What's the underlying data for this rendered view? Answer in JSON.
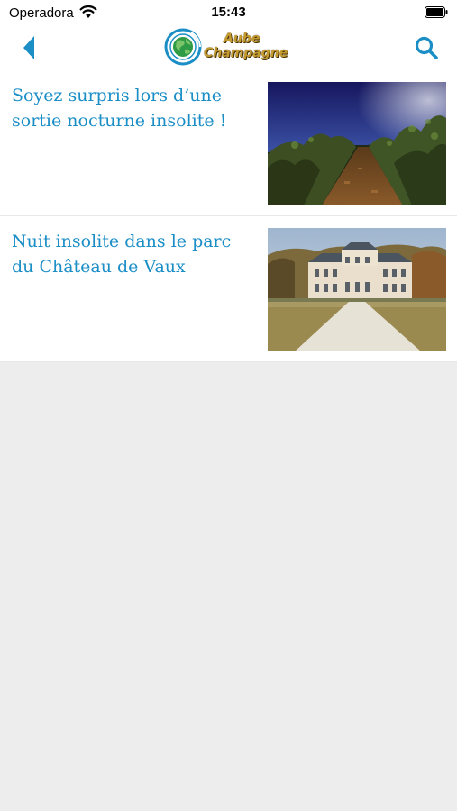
{
  "status_bar": {
    "carrier": "Operadora",
    "time": "15:43"
  },
  "header": {
    "logo_line1": "Aube",
    "logo_line2": "Champagne",
    "back_icon": "chevron-left-icon",
    "search_icon": "search-icon"
  },
  "articles": [
    {
      "title": "Soyez surpris lors d’une sortie nocturne insolite !",
      "thumbnail": "vineyard-night-image"
    },
    {
      "title": "Nuit insolite dans le parc du Château de Vaux",
      "thumbnail": "chateau-de-vaux-image"
    }
  ],
  "colors": {
    "accent": "#1b8ec6",
    "background": "#ededed",
    "logo_gold": "#c59a2f"
  }
}
